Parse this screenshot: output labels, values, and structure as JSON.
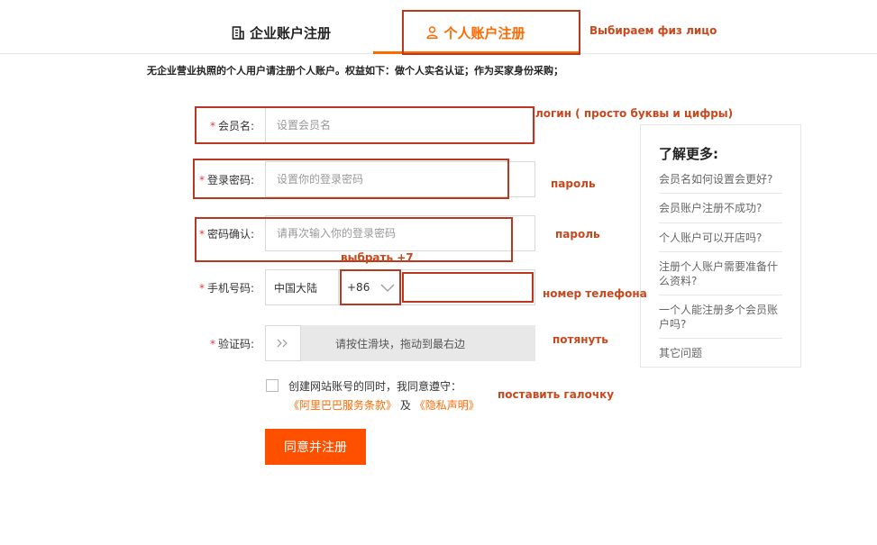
{
  "tabs": {
    "company": "企业账户注册",
    "personal": "个人账户注册"
  },
  "note": "无企业营业执照的个人用户请注册个人账户。权益如下：做个人实名认证；作为买家身份采购；",
  "form": {
    "star": "*",
    "member_name": {
      "label": "会员名:",
      "placeholder": "设置会员名"
    },
    "password": {
      "label": "登录密码:",
      "placeholder": "设置你的登录密码"
    },
    "password_confirm": {
      "label": "密码确认:",
      "placeholder": "请再次输入你的登录密码"
    },
    "phone": {
      "label": "手机号码:",
      "region": "中国大陆",
      "code": "+86",
      "value": ""
    },
    "captcha": {
      "label": "验证码:",
      "slider_text": "请按住滑块，拖动到最右边"
    },
    "agreement": {
      "text": "创建网站账号的同时，我同意遵守：",
      "terms_link": "《阿里巴巴服务条款》",
      "and": "及",
      "privacy_link": "《隐私声明》"
    },
    "submit": "同意并注册"
  },
  "sidebar": {
    "title": "了解更多:",
    "items": [
      "会员名如何设置会更好?",
      "会员账户注册不成功?",
      "个人账户可以开店吗?",
      "注册个人账户需要准备什么资料?",
      "一个人能注册多个会员账户吗?",
      "其它问题"
    ]
  },
  "annotations": {
    "tab": "Выбираем физ лицо",
    "login": "логин ( просто буквы и цифры)",
    "password": "пароль",
    "password_confirm": "пароль",
    "code": "выбрать +7",
    "phone": "номер телефона",
    "slider": "потянуть",
    "checkbox": "поставить галочку"
  },
  "colors": {
    "accent": "#ff6a00",
    "submit": "#ff5000",
    "annotation": "#b9381f",
    "required_star": "#e4393c"
  }
}
